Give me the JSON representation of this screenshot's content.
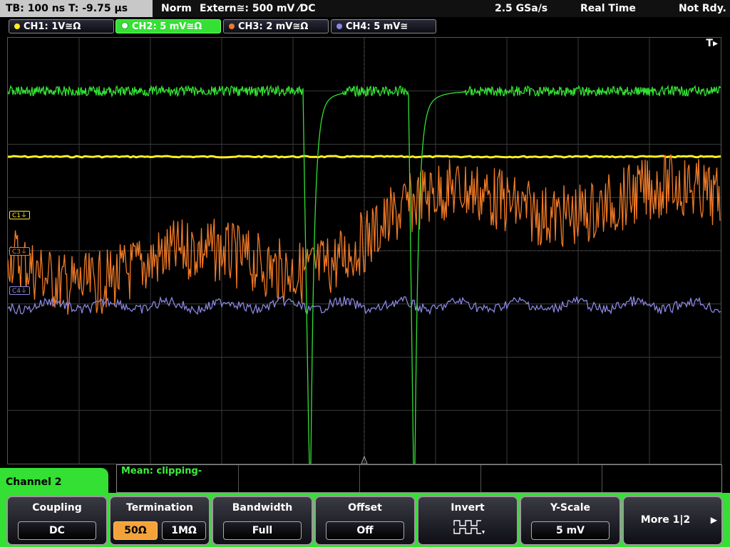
{
  "topbar": {
    "timebase": "TB: 100 ns   T: -9.75 µs",
    "mode": "Norm",
    "trigger": "Extern≅: 500 mV ⁄DC",
    "sample_rate": "2.5 GSa/s",
    "acq_mode": "Real Time",
    "status": "Not Rdy."
  },
  "channels": [
    {
      "label": "CH1: 1V≅Ω",
      "color": "#ffee22"
    },
    {
      "label": "CH2: 5 mV≅Ω",
      "color": "#33e033"
    },
    {
      "label": "CH3: 2 mV≅Ω",
      "color": "#f07a26"
    },
    {
      "label": "CH4: 5 mV≅",
      "color": "#8a86e0"
    }
  ],
  "trigger_icon": "T▸",
  "markers": {
    "c1": "C1⏚",
    "c3": "C3⏚",
    "c4": "C4⏚"
  },
  "measurement": {
    "text": "Mean: clipping-"
  },
  "menu_title": "Channel 2",
  "softkeys": {
    "coupling": {
      "title": "Coupling",
      "value": "DC"
    },
    "termination": {
      "title": "Termination",
      "opt1": "50Ω",
      "opt2": "1MΩ"
    },
    "bandwidth": {
      "title": "Bandwidth",
      "value": "Full"
    },
    "offset": {
      "title": "Offset",
      "value": "Off"
    },
    "invert": {
      "title": "Invert",
      "icon": "invert-waveform-icon"
    },
    "yscale": {
      "title": "Y-Scale",
      "value": "5 mV"
    },
    "more": {
      "label": "More 1|2"
    }
  }
}
